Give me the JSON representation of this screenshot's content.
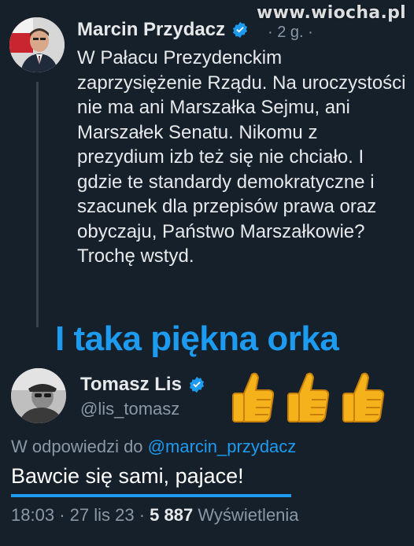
{
  "watermark": "www.wiocha.pl",
  "tweet": {
    "author_name": "Marcin Przydacz",
    "meta": "· 2 g. ·",
    "text": "W Pałacu Prezydenckim zaprzysiężenie Rządu. Na uroczystości nie ma ani Marszałka Sejmu, ani Marszałek Senatu. Nikomu z prezydium izb też się nie chciało. I gdzie te standardy demokratyczne i szacunek dla przepisów prawa oraz obyczaju, Państwo Marszałkowie? Trochę wstyd."
  },
  "caption": "I taka piękna orka",
  "reply": {
    "author_name": "Tomasz Lis",
    "handle": "@lis_tomasz",
    "reply_to_prefix": "W odpowiedzi do",
    "reply_to_handle": "@marcin_przydacz",
    "text": "Bawcie się sami, pajace!",
    "time": "18:03",
    "date": "27 lis 23",
    "views_count": "5 887",
    "views_label": "Wyświetlenia"
  },
  "emojis": [
    "thumbs-up",
    "thumbs-up",
    "thumbs-up"
  ],
  "colors": {
    "background": "#15202b",
    "accent": "#1d9bf0",
    "secondary_text": "#8b98a5"
  }
}
